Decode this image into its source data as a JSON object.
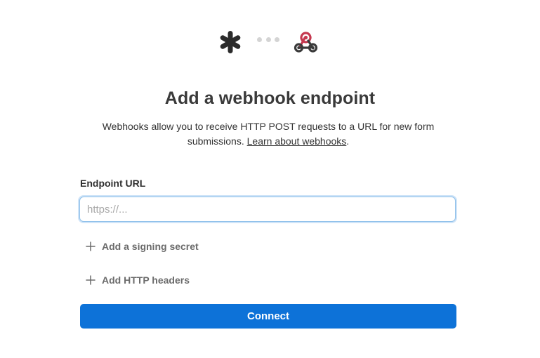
{
  "header": {
    "source_icon": "asterisk-logo-icon",
    "connector_icon": "ellipsis-dots-icon",
    "target_icon": "webhook-icon"
  },
  "title": "Add a webhook endpoint",
  "description": {
    "text": "Webhooks allow you to receive HTTP POST requests to a URL for new form submissions. ",
    "link_text": "Learn about webhooks",
    "suffix": "."
  },
  "endpoint": {
    "label": "Endpoint URL",
    "value": "",
    "placeholder": "https://..."
  },
  "options": {
    "signing_secret_label": "Add a signing secret",
    "http_headers_label": "Add HTTP headers"
  },
  "connect_label": "Connect",
  "colors": {
    "primary": "#0d72d8",
    "input_focus_border": "#8fc0ea",
    "webhook_red": "#c5384f",
    "webhook_dark": "#3a3a3a"
  }
}
